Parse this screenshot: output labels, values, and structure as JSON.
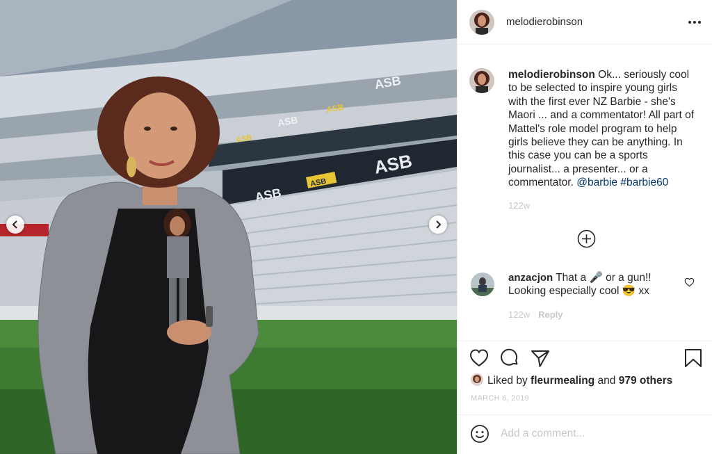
{
  "post": {
    "username": "melodierobinson",
    "caption": {
      "text_before": " Ok... seriously cool to be selected to inspire young girls with the first ever NZ Barbie - she's Maori ... and a commentator! All part of Mattel's role model program to help girls believe they can be anything. In this case you can be a sports journalist... a presenter... or a commentator. ",
      "mention": "@barbie",
      "hashtag": "#barbie60"
    },
    "caption_age": "122w",
    "comments": [
      {
        "username": "anzacjon",
        "text": " That a 🎤 or a gun!! Looking especially cool 😎 xx",
        "age": "122w",
        "reply_label": "Reply"
      }
    ],
    "likes": {
      "prefix": "Liked by ",
      "user": "fleurmealing",
      "middle": " and ",
      "others": "979 others"
    },
    "date": "MARCH 6, 2019",
    "add_comment_placeholder": "Add a comment..."
  },
  "photo": {
    "stadium_signs": [
      "ASB",
      "ASB",
      "ASB",
      "ASB",
      "ASB",
      "ASB",
      "ASB"
    ]
  },
  "icons": {
    "header_more": "more-options-icon",
    "carousel_prev": "chevron-left-icon",
    "carousel_next": "chevron-right-icon",
    "load_more": "plus-circle-icon",
    "comment_like": "heart-icon",
    "action_like": "heart-icon",
    "action_comment": "comment-bubble-icon",
    "action_share": "paper-plane-icon",
    "action_save": "bookmark-icon",
    "emoji": "smiley-icon"
  },
  "colors": {
    "text": "#262626",
    "muted": "#c7c7c7",
    "link": "#00376b",
    "divider": "#efefef",
    "sign_yellow": "#e8c534"
  }
}
